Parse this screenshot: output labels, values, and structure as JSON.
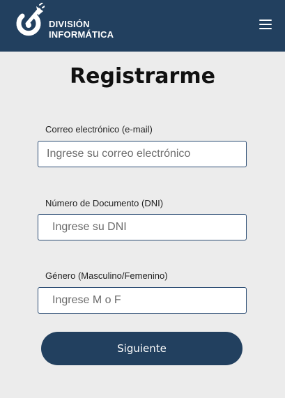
{
  "header": {
    "brand_line1": "DIVISIÓN",
    "brand_line2": "INFORMÁTICA",
    "logo_icon": "plug-power-icon",
    "menu_icon": "hamburger-menu-icon"
  },
  "form": {
    "title": "Registrarme",
    "email": {
      "label": "Correo electrónico (e-mail)",
      "placeholder": "Ingrese su correo electrónico",
      "value": ""
    },
    "dni": {
      "label": "Número de Documento (DNI)",
      "placeholder": "Ingrese su DNI",
      "value": ""
    },
    "gender": {
      "label": "Género (Masculino/Femenino)",
      "placeholder": "Ingrese M o F",
      "value": ""
    },
    "submit_label": "Siguiente"
  },
  "colors": {
    "header_bg": "#22405f",
    "page_bg": "#ececec",
    "button_bg": "#22405f",
    "field_border": "#2b4c73"
  }
}
